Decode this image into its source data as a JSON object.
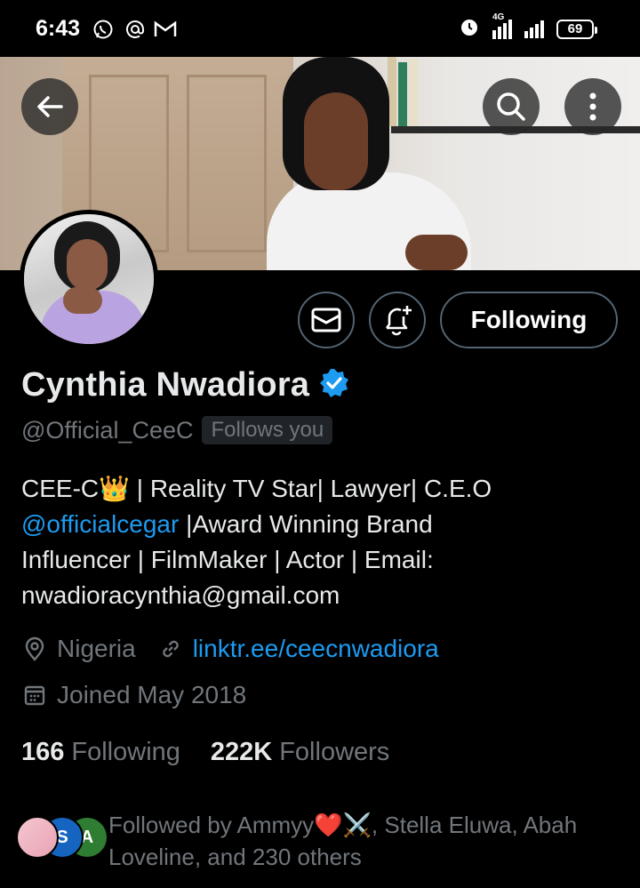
{
  "status_bar": {
    "time": "6:43",
    "network": "4G",
    "battery": "69"
  },
  "profile": {
    "display_name": "Cynthia Nwadiora",
    "handle": "@Official_CeeC",
    "follows_you": "Follows you",
    "verified": true,
    "follow_button": "Following",
    "bio": {
      "line1": "CEE-C👑 | Reality TV Star| Lawyer| C.E.O",
      "mention": "@officialcegar",
      "line2_rest": " |Award Winning Brand",
      "line3": "Influencer | FilmMaker | Actor | Email:",
      "line4": "nwadioracynthia@gmail.com"
    },
    "location": "Nigeria",
    "website": "linktr.ee/ceecnwadiora",
    "joined": "Joined May 2018",
    "following_count": "166",
    "following_label": "Following",
    "followers_count": "222K",
    "followers_label": "Followers",
    "followed_by": {
      "line1": "Followed by Ammyy❤️⚔️, Stella Eluwa, Abah",
      "line2": "Loveline, and 230 others",
      "avatar_letters": [
        "S",
        "A"
      ]
    }
  },
  "colors": {
    "accent": "#1d9bf0",
    "muted": "#71767b",
    "border": "#536471",
    "background": "#000000"
  }
}
